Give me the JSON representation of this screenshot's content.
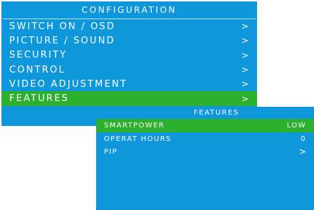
{
  "main_menu": {
    "title": "CONFIGURATION",
    "items": [
      {
        "label": "SWITCH ON / OSD",
        "arrow": ">"
      },
      {
        "label": "PICTURE / SOUND",
        "arrow": ">"
      },
      {
        "label": "SECURITY",
        "arrow": ">"
      },
      {
        "label": "CONTROL",
        "arrow": ">"
      },
      {
        "label": "VIDEO ADJUSTMENT",
        "arrow": ">"
      },
      {
        "label": "FEATURES",
        "arrow": ">",
        "selected": true
      }
    ]
  },
  "sub_menu": {
    "title": "FEATURES",
    "items": [
      {
        "label": "SMARTPOWER",
        "value": "LOW",
        "selected": true
      },
      {
        "label": "OPERAT HOURS",
        "value": "0"
      },
      {
        "label": "PIP",
        "value": ">"
      }
    ]
  },
  "colors": {
    "panel_background": "#0f97dc",
    "selection_highlight": "#2cb02e",
    "text": "#ffffff"
  }
}
